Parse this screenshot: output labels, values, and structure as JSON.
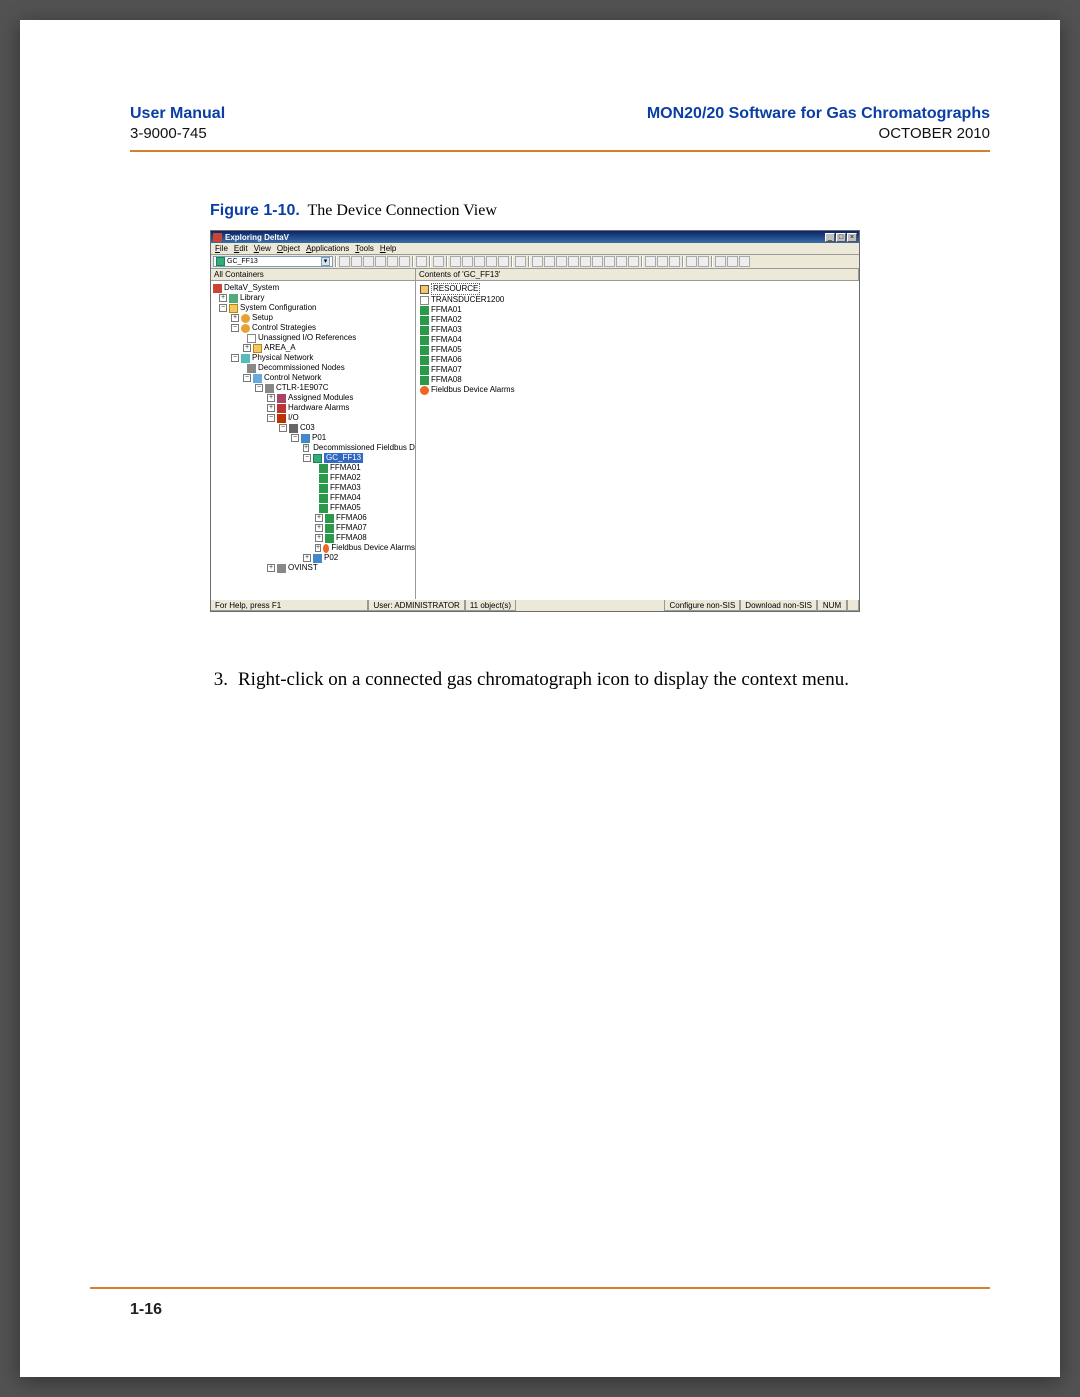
{
  "header": {
    "left": "User Manual",
    "right": "MON20/20 Software for Gas Chromatographs",
    "doc_no": "3-9000-745",
    "date": "OCTOBER 2010"
  },
  "figure": {
    "label": "Figure 1-10.",
    "caption": "The Device Connection View"
  },
  "win": {
    "title": "Exploring DeltaV",
    "menus": {
      "file": "File",
      "edit": "Edit",
      "view": "View",
      "object": "Object",
      "applications": "Applications",
      "tools": "Tools",
      "help": "Help"
    },
    "combo": "GC_FF13",
    "col_left": "All Containers",
    "col_right": "Contents of 'GC_FF13'",
    "tree": {
      "root": "DeltaV_System",
      "library": "Library",
      "syscfg": "System Configuration",
      "setup": "Setup",
      "ctrlstrat": "Control Strategies",
      "unassigned": "Unassigned I/O References",
      "area_a": "AREA_A",
      "physnet": "Physical Network",
      "decomm": "Decommissioned Nodes",
      "ctrlnet": "Control Network",
      "ctlr": "CTLR-1E907C",
      "assigned": "Assigned Modules",
      "hwalarms": "Hardware Alarms",
      "io": "I/O",
      "c03": "C03",
      "p01": "P01",
      "decommfb": "Decommissioned Fieldbus Devices",
      "gc": "GC_FF13",
      "ffma": [
        "FFMA01",
        "FFMA02",
        "FFMA03",
        "FFMA04",
        "FFMA05",
        "FFMA06",
        "FFMA07",
        "FFMA08"
      ],
      "fbalarms": "Fieldbus Device Alarms",
      "p02": "P02",
      "ovinst": "OVINST"
    },
    "list": {
      "resource": "RESOURCE",
      "transducer": "TRANSDUCER1200",
      "ffma": [
        "FFMA01",
        "FFMA02",
        "FFMA03",
        "FFMA04",
        "FFMA05",
        "FFMA06",
        "FFMA07",
        "FFMA08"
      ],
      "fbalarms": "Fieldbus Device Alarms"
    },
    "status": {
      "help": "For Help, press F1",
      "user": "User: ADMINISTRATOR",
      "count": "11 object(s)",
      "cfg": "Configure non-SIS",
      "dl": "Download non-SIS",
      "num": "NUM"
    }
  },
  "step": {
    "num": "3.",
    "text": "Right-click on a connected gas chromatograph icon to display the context menu."
  },
  "page_num": "1-16"
}
